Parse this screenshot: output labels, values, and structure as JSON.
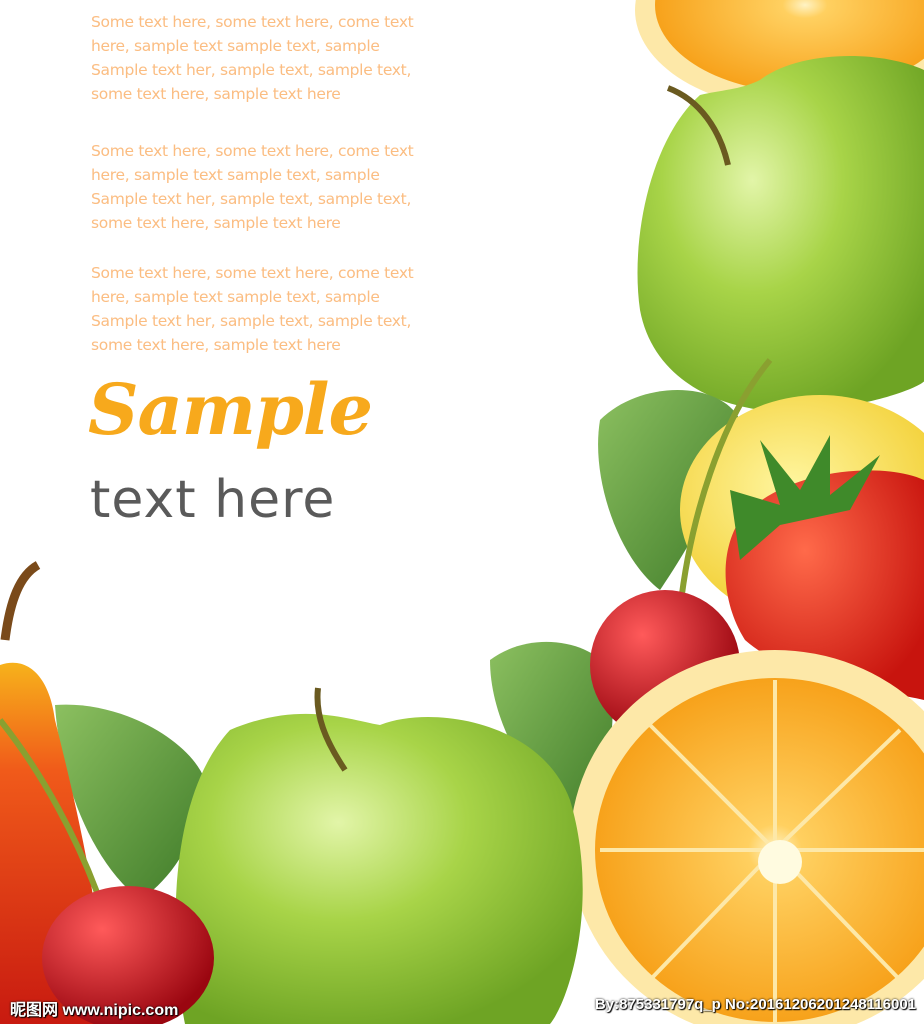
{
  "paragraphs": [
    {
      "lines": [
        "Some text here, some text here, come text",
        "here, sample text  sample text, sample",
        "Sample text her, sample text, sample text,",
        "some text here, sample text here"
      ]
    },
    {
      "lines": [
        "Some text here, some text here, come text",
        "here, sample text  sample text, sample",
        "Sample text her, sample text, sample text,",
        "some text here, sample text here"
      ]
    },
    {
      "lines": [
        "Some text here, some text here, come text",
        "here, sample text  sample text, sample",
        "Sample text her, sample text, sample text,",
        "some text here, sample text here"
      ]
    }
  ],
  "headline": {
    "title": "Sample",
    "subtitle": "text here"
  },
  "watermark": {
    "left": "昵图网 www.nipic.com",
    "right": "By:875331797q_p No:20161206201248116001"
  },
  "colors": {
    "paragraph": "#fbbd82",
    "title": "#f7a91c",
    "subtitle": "#5a5a5a",
    "apple": "#9ccc3c",
    "orange": "#f7a21b",
    "strawberry": "#e8261c",
    "cherry": "#c8101a",
    "leaf": "#5a9a3a"
  }
}
